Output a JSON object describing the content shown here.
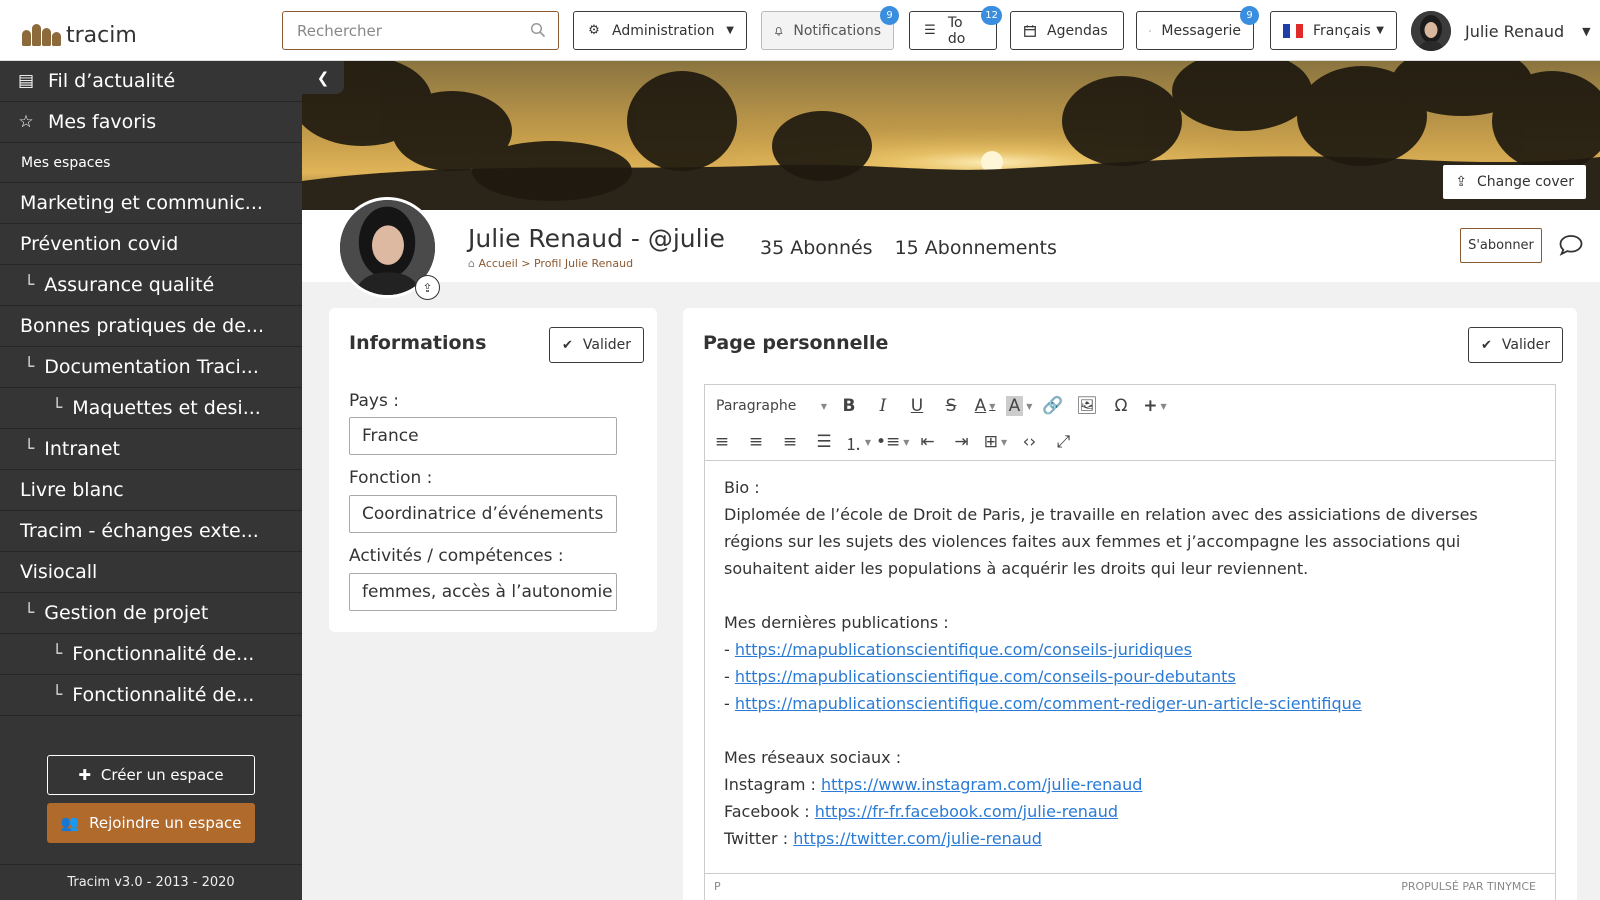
{
  "header": {
    "logo_text": "tracim",
    "search_placeholder": "Rechercher",
    "administration": "Administration",
    "notifications": {
      "label": "Notifications",
      "badge": "9"
    },
    "todo": {
      "label": "To do",
      "badge": "12"
    },
    "agendas": "Agendas",
    "messagerie": {
      "label": "Messagerie",
      "badge": "9"
    },
    "language": "Français",
    "user_name": "Julie Renaud"
  },
  "sidebar": {
    "feed": "Fil d’actualité",
    "favorites": "Mes favoris",
    "my_spaces_label": "Mes espaces",
    "spaces": [
      {
        "label": "Marketing et communic...",
        "level": 0
      },
      {
        "label": "Prévention covid",
        "level": 0
      },
      {
        "label": "Assurance qualité",
        "level": 1
      },
      {
        "label": "Bonnes pratiques de de...",
        "level": 0
      },
      {
        "label": "Documentation Traci...",
        "level": 1
      },
      {
        "label": "Maquettes et desi...",
        "level": 2
      },
      {
        "label": "Intranet",
        "level": 1
      },
      {
        "label": "Livre blanc",
        "level": 0
      },
      {
        "label": "Tracim - échanges exte...",
        "level": 0
      },
      {
        "label": "Visiocall",
        "level": 0
      },
      {
        "label": "Gestion de projet",
        "level": 1
      },
      {
        "label": "Fonctionnalité de...",
        "level": 2
      },
      {
        "label": "Fonctionnalité de...",
        "level": 2
      }
    ],
    "create_space": "Créer un espace",
    "join_space": "Rejoindre un espace",
    "version": "Tracim v3.0 - 2013 - 2020"
  },
  "cover": {
    "change_cover": "Change cover"
  },
  "profile": {
    "name": "Julie Renaud - @julie",
    "breadcrumb_home": "Accueil",
    "breadcrumb_sep": ">",
    "breadcrumb_current": "Profil Julie Renaud",
    "followers": "35 Abonnés",
    "following": "15 Abonnements",
    "subscribe": "S'abonner"
  },
  "info_card": {
    "title": "Informations",
    "validate": "Valider",
    "country_label": "Pays :",
    "country_value": "France",
    "function_label": "Fonction :",
    "function_value": "Coordinatrice d’événements",
    "skills_label": "Activités / compétences :",
    "skills_value": "femmes, accès à l’autonomie"
  },
  "page_card": {
    "title": "Page personnelle",
    "validate": "Valider",
    "toolbar_paragraph": "Paragraphe",
    "bio_heading": "Bio :",
    "bio_line1": "Diplomée de l’école de Droit de Paris, je travaille en relation avec des assiciations de diverses",
    "bio_line2": "régions sur les sujets des violences faites aux femmes et j’accompagne les associations qui",
    "bio_line3": "souhaitent aider les populations à acquérir les droits qui leur reviennent.",
    "pubs_heading": "Mes dernières publications :",
    "pub_prefix": "- ",
    "pubs": [
      "https://mapublicationscientifique.com/conseils-juridiques",
      "https://mapublicationscientifique.com/conseils-pour-debutants",
      "https://mapublicationscientifique.com/comment-rediger-un-article-scientifique"
    ],
    "social_heading": "Mes réseaux sociaux :",
    "instagram_label": "Instagram : ",
    "instagram_url": "https://www.instagram.com/julie-renaud",
    "facebook_label": "Facebook : ",
    "facebook_url": "https://fr-fr.facebook.com/julie-renaud",
    "twitter_label": "Twitter : ",
    "twitter_url": "https://twitter.com/julie-renaud",
    "status_path": "P",
    "powered_by": "PROPULSÉ PAR TINYMCE"
  },
  "colors": {
    "accent": "#8a5a32",
    "join_button": "#b06a2c",
    "sidebar_bg": "#353535",
    "badge": "#3a8ee0",
    "link": "#2a7bd6"
  }
}
